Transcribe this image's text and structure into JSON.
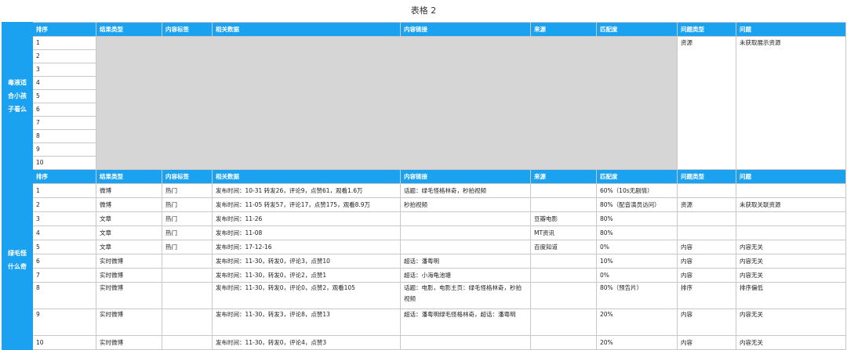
{
  "title": "表格 2",
  "headers": [
    "排序",
    "结果类型",
    "内容标签",
    "相关数据",
    "内容链接",
    "来源",
    "匹配度",
    "问题类型",
    "问题"
  ],
  "section1": {
    "query": "毒液适合小孩子看么",
    "rank_numbers": [
      "1",
      "2",
      "3",
      "4",
      "5",
      "6",
      "7",
      "8",
      "9",
      "10"
    ],
    "issue_type": "资源",
    "issue": "未获取展示资源"
  },
  "section2": {
    "query": "绿毛怪什么奇",
    "rows": [
      {
        "rank": "1",
        "type": "微博",
        "tag": "热门",
        "data": "发布时间：10-31  转发26，评论9，点赞61，观看1.6万",
        "link": "话题：绿毛怪格林奇，秒拍视频",
        "source": "",
        "match": "60%（10s无剧情）",
        "issue_type": "",
        "issue": ""
      },
      {
        "rank": "2",
        "type": "微博",
        "tag": "热门",
        "data": "发布时间：11-05  转发57，评论17，点赞175，观看8.9万",
        "link": "秒拍视频",
        "source": "",
        "match": "80%（配音演员访问）",
        "issue_type": "资源",
        "issue": "未获取关联资源"
      },
      {
        "rank": "3",
        "type": "文章",
        "tag": "热门",
        "data": "发布时间：11-26",
        "link": "",
        "source": "豆瓣电影",
        "match": "80%",
        "issue_type": "",
        "issue": ""
      },
      {
        "rank": "4",
        "type": "文章",
        "tag": "热门",
        "data": "发布时间：11-08",
        "link": "",
        "source": "MT资讯",
        "match": "80%",
        "issue_type": "",
        "issue": ""
      },
      {
        "rank": "5",
        "type": "文章",
        "tag": "热门",
        "data": "发布时间：17-12-16",
        "link": "",
        "source": "百度知道",
        "match": "0%",
        "issue_type": "内容",
        "issue": "内容无关"
      },
      {
        "rank": "6",
        "type": "实时微博",
        "tag": "",
        "data": "发布时间：11-30，转发0，评论3，点赞10",
        "link": "超话：潘粤明",
        "source": "",
        "match": "10%",
        "issue_type": "内容",
        "issue": "内容无关"
      },
      {
        "rank": "7",
        "type": "实时微博",
        "tag": "",
        "data": "发布时间：11-30，转发0，评论2，点赞1",
        "link": "超话：小海龟池塘",
        "source": "",
        "match": "0%",
        "issue_type": "内容",
        "issue": "内容无关"
      },
      {
        "rank": "8",
        "type": "实时微博",
        "tag": "",
        "data": "发布时间：11-30，转发0，评论0，点赞2，观看105",
        "link": "话题：电影，电影主页：绿毛怪格林奇，秒拍视频",
        "source": "",
        "match": "80%（预告片）",
        "issue_type": "排序",
        "issue": "排序偏低"
      },
      {
        "rank": "9",
        "type": "实时微博",
        "tag": "",
        "data": "发布时间：11-30，转发3，评论8，点赞13",
        "link": "超话：潘粤明绿毛怪格林奇，超话：潘粤明",
        "source": "",
        "match": "20%",
        "issue_type": "内容",
        "issue": "内容无关"
      },
      {
        "rank": "10",
        "type": "实时微博",
        "tag": "",
        "data": "发布时间：11-30，转发0，评论4，点赞3",
        "link": "",
        "source": "",
        "match": "20%",
        "issue_type": "内容",
        "issue": "内容无关"
      }
    ]
  }
}
